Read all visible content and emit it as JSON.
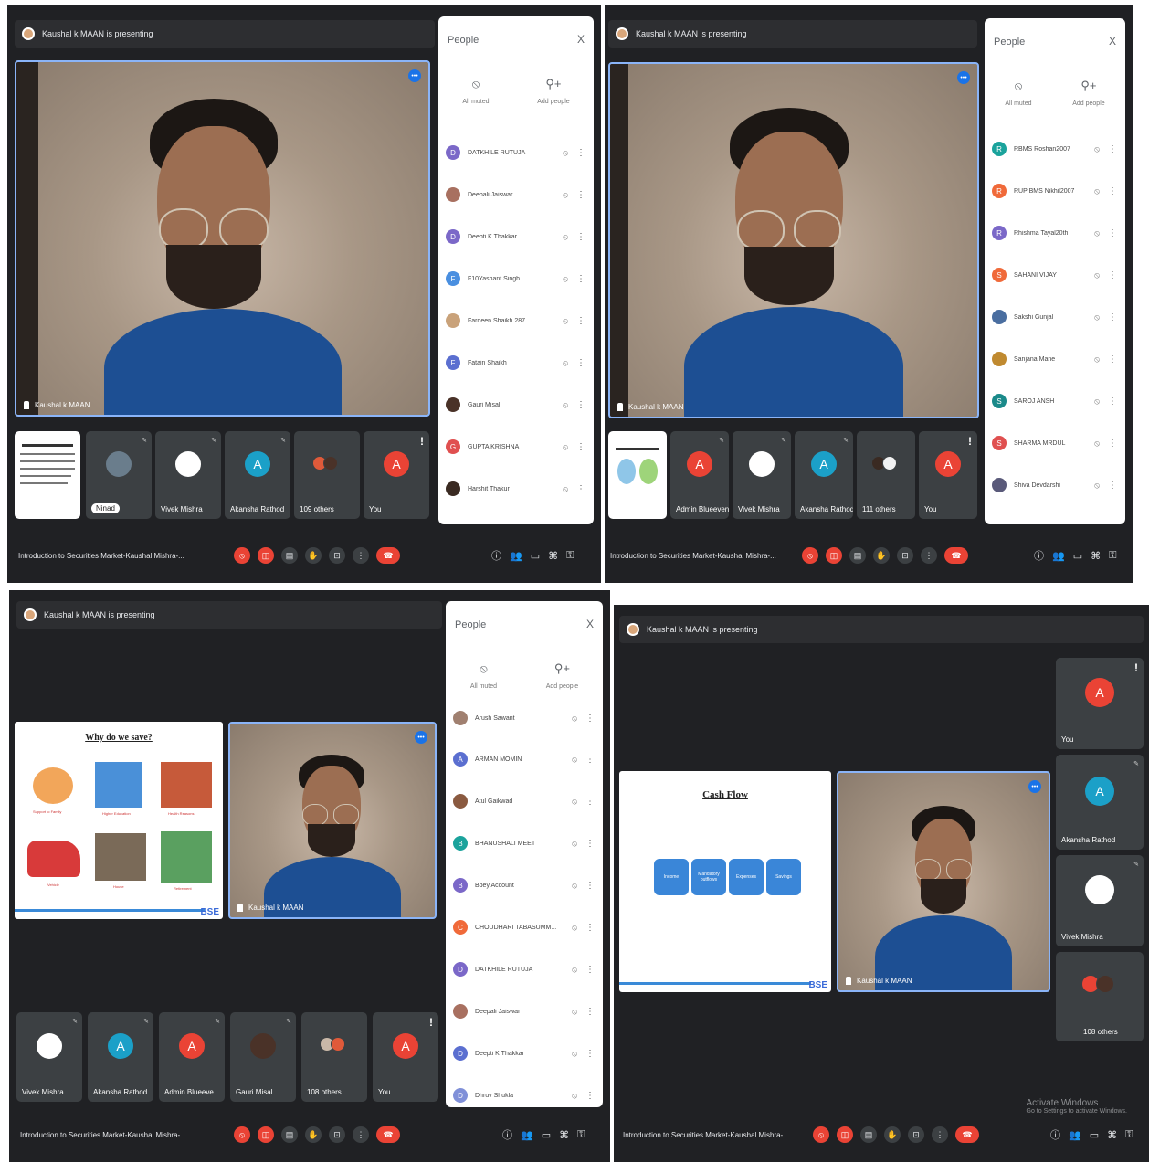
{
  "banner_text": "Kaushal k MAAN is presenting",
  "meeting_title": "Introduction to Securities Market-Kaushal Mishra-...",
  "presenter_name": "Kaushal k MAAN",
  "people_panel": {
    "title": "People",
    "close": "X",
    "all_muted": "All muted",
    "add_people": "Add people"
  },
  "screen1": {
    "participants": [
      {
        "initial": "D",
        "name": "DATKHILE RUTUJA",
        "color": "#7b68c8"
      },
      {
        "initial": "",
        "name": "Deepali Jaiswar",
        "color": "#a87060"
      },
      {
        "initial": "D",
        "name": "Deepti K Thakkar",
        "color": "#7b68c8"
      },
      {
        "initial": "F",
        "name": "F10Yashant Singh",
        "color": "#4a8fe0"
      },
      {
        "initial": "",
        "name": "Fardeen Shaikh 287",
        "color": "#c9a27a"
      },
      {
        "initial": "F",
        "name": "Fatain Shaikh",
        "color": "#5b6fd0"
      },
      {
        "initial": "",
        "name": "Gauri Misal",
        "color": "#4a3228"
      },
      {
        "initial": "G",
        "name": "GUPTA KRISHNA",
        "color": "#e05050"
      },
      {
        "initial": "",
        "name": "Harshit Thakur",
        "color": "#3a2a22"
      }
    ],
    "tiles": [
      {
        "name": "Ninad"
      },
      {
        "name": "Vivek Mishra"
      },
      {
        "name": "Akansha Rathod",
        "initial": "A"
      },
      {
        "name": "109 others"
      },
      {
        "name": "You",
        "initial": "A"
      }
    ]
  },
  "screen2": {
    "participants": [
      {
        "initial": "R",
        "name": "RBMS Roshan2007",
        "color": "#1ba39c"
      },
      {
        "initial": "R",
        "name": "RUP BMS Nikhil2007",
        "color": "#f06a3a"
      },
      {
        "initial": "R",
        "name": "Rhishma Tayal20th",
        "color": "#7b68c8"
      },
      {
        "initial": "S",
        "name": "SAHANI VIJAY",
        "color": "#f06a3a"
      },
      {
        "initial": "",
        "name": "Sakshi Gunjal",
        "color": "#4a6ea0"
      },
      {
        "initial": "",
        "name": "Sanjana Mane",
        "color": "#c08a30"
      },
      {
        "initial": "S",
        "name": "SAROJ ANSH",
        "color": "#1b8a8a"
      },
      {
        "initial": "S",
        "name": "SHARMA MRDUL",
        "color": "#e05050"
      },
      {
        "initial": "",
        "name": "Shiva Devdarshi",
        "color": "#5a5a7a"
      }
    ],
    "tiles": [
      {
        "name": "Admin Blueeven...",
        "initial": "A"
      },
      {
        "name": "Vivek Mishra"
      },
      {
        "name": "Akansha Rathod",
        "initial": "A"
      },
      {
        "name": "111 others"
      },
      {
        "name": "You",
        "initial": "A"
      }
    ]
  },
  "screen3": {
    "slide_title": "Why do we save?",
    "slide_captions": [
      "Support to Family",
      "Higher Education",
      "Health Reasons",
      "Vehicle",
      "House",
      "Retirement"
    ],
    "slide_logo": "BSE",
    "participants": [
      {
        "initial": "",
        "name": "Arush Sawant",
        "color": "#a08070"
      },
      {
        "initial": "A",
        "name": "ARMAN MOMIN",
        "color": "#5b6fd0"
      },
      {
        "initial": "",
        "name": "Atul Gaikwad",
        "color": "#8a5a40"
      },
      {
        "initial": "B",
        "name": "BHANUSHALI MEET",
        "color": "#1ba39c"
      },
      {
        "initial": "B",
        "name": "Bbey Account",
        "color": "#7b68c8"
      },
      {
        "initial": "C",
        "name": "CHOUDHARI TABASUMM...",
        "color": "#f06a3a"
      },
      {
        "initial": "D",
        "name": "DATKHILE RUTUJA",
        "color": "#7b68c8"
      },
      {
        "initial": "",
        "name": "Deepali Jaiswar",
        "color": "#a87060"
      },
      {
        "initial": "D",
        "name": "Deepti K Thakkar",
        "color": "#5b6fd0"
      },
      {
        "initial": "D",
        "name": "Dhruv Shukla",
        "color": "#8090d8"
      }
    ],
    "tiles": [
      {
        "name": "Vivek Mishra"
      },
      {
        "name": "Akansha Rathod",
        "initial": "A"
      },
      {
        "name": "Admin Blueeve...",
        "initial": "A"
      },
      {
        "name": "Gauri Misal"
      },
      {
        "name": "108 others"
      },
      {
        "name": "You",
        "initial": "A"
      }
    ]
  },
  "screen4": {
    "slide_title": "Cash Flow",
    "flow_boxes": [
      "Income",
      "Mandatory outflows",
      "Expenses",
      "Savings"
    ],
    "slide_logo": "BSE",
    "tiles": [
      {
        "name": "You",
        "initial": "A"
      },
      {
        "name": "Akansha Rathod",
        "initial": "A"
      },
      {
        "name": "Vivek Mishra"
      },
      {
        "name": "108 others"
      }
    ],
    "watermark_title": "Activate Windows",
    "watermark_sub": "Go to Settings to activate Windows."
  },
  "colors": {
    "accent": "#8ab4f8",
    "danger": "#ea4335",
    "teal": "#1ba0c8",
    "panel": "#202124",
    "tile": "#3c4043"
  }
}
